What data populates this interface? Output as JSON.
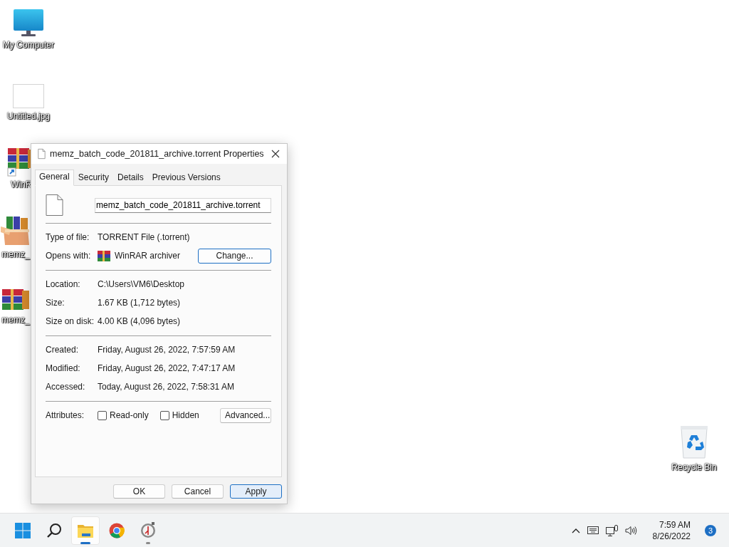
{
  "desktop_icons": [
    {
      "kind": "computer",
      "label": "My Computer"
    },
    {
      "kind": "blank_image",
      "label": "Untitled.jpg"
    },
    {
      "kind": "winrar_shortcut",
      "label": "WinR"
    },
    {
      "kind": "archive_box",
      "label": "memz_"
    },
    {
      "kind": "winrar_file",
      "label": "memz_"
    },
    {
      "kind": "recycle_bin",
      "label": "Recycle Bin"
    }
  ],
  "dialog": {
    "title": "memz_batch_code_201811_archive.torrent Properties",
    "tabs": [
      {
        "label": "General",
        "selected": true
      },
      {
        "label": "Security",
        "selected": false
      },
      {
        "label": "Details",
        "selected": false
      },
      {
        "label": "Previous Versions",
        "selected": false
      }
    ],
    "file_name": "memz_batch_code_201811_archive.torrent",
    "sections": [
      [
        {
          "kind": "text",
          "label": "Type of file:",
          "value": "TORRENT File (.torrent)"
        },
        {
          "kind": "opens_with",
          "label": "Opens with:",
          "value": "WinRAR archiver",
          "button": "Change..."
        }
      ],
      [
        {
          "kind": "text",
          "label": "Location:",
          "value": "C:\\Users\\VM6\\Desktop"
        },
        {
          "kind": "text",
          "label": "Size:",
          "value": "1.67 KB (1,712 bytes)"
        },
        {
          "kind": "text",
          "label": "Size on disk:",
          "value": "4.00 KB (4,096 bytes)"
        }
      ],
      [
        {
          "kind": "text",
          "label": "Created:",
          "value": "Friday, August 26, 2022, 7:57:59 AM"
        },
        {
          "kind": "text",
          "label": "Modified:",
          "value": "Friday, August 26, 2022, 7:47:17 AM"
        },
        {
          "kind": "text",
          "label": "Accessed:",
          "value": "Today, August 26, 2022, 7:58:31 AM"
        }
      ],
      [
        {
          "kind": "attributes",
          "label": "Attributes:",
          "checkboxes": [
            {
              "label": "Read-only",
              "checked": false
            },
            {
              "label": "Hidden",
              "checked": false
            }
          ],
          "button": "Advanced..."
        }
      ]
    ],
    "buttons": [
      {
        "label": "OK",
        "highlighted": false
      },
      {
        "label": "Cancel",
        "highlighted": false
      },
      {
        "label": "Apply",
        "highlighted": true
      }
    ]
  },
  "taskbar": {
    "apps": [
      {
        "kind": "start",
        "active": false,
        "running": false
      },
      {
        "kind": "search",
        "active": false,
        "running": false
      },
      {
        "kind": "file_explorer",
        "active": true,
        "running": true
      },
      {
        "kind": "chrome",
        "active": false,
        "running": false
      },
      {
        "kind": "clock",
        "active": false,
        "running": true
      }
    ],
    "time": "7:59 AM",
    "date": "8/26/2022",
    "notification_count": "3"
  }
}
